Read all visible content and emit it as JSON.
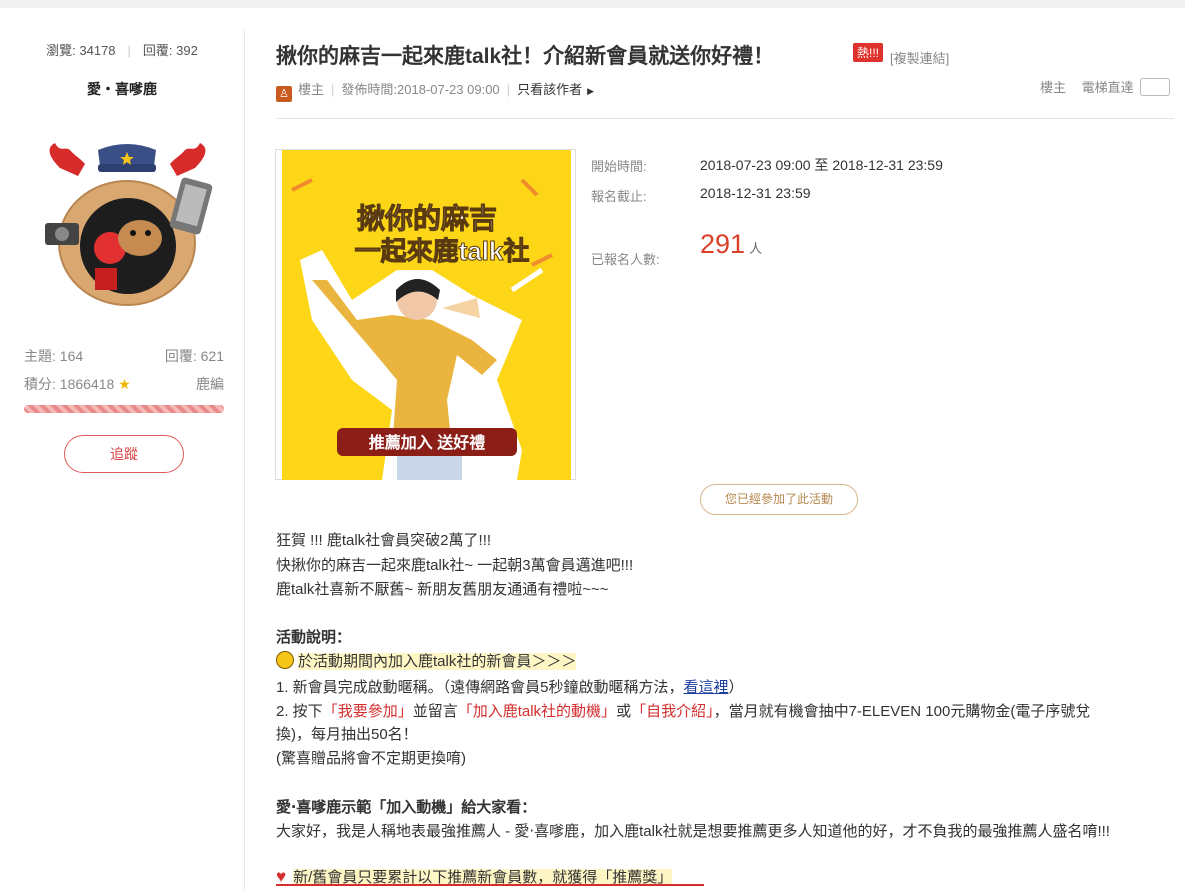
{
  "user": {
    "views_label": "瀏覽: 34178",
    "replies_label": "回覆: 392",
    "name": "愛・喜嗲鹿",
    "topics": "主題: 164",
    "reply_count": "回覆: 621",
    "points": "積分: 1866418",
    "rank": "鹿編",
    "follow_label": "追蹤"
  },
  "post": {
    "title": "揪你的麻吉一起來鹿talk社！介紹新會員就送你好禮！",
    "hot_badge": "熱!!!",
    "copy_link": "[複製連結]",
    "meta": {
      "floor": "樓主",
      "published": "發佈時間:2018-07-23 09:00",
      "author_only": "只看該作者"
    },
    "tools": {
      "floor": "樓主",
      "elevator": "電梯直達"
    }
  },
  "poster": {
    "line1": "揪你的麻吉",
    "line2": "一起來鹿talk社",
    "cta": "推薦加入 送好禮"
  },
  "event": {
    "start_label": "開始時間:",
    "start_value": "2018-07-23 09:00 至 2018-12-31 23:59",
    "deadline_label": "報名截止:",
    "deadline_value": "2018-12-31 23:59",
    "count_label": "已報名人數:",
    "count_value": "291",
    "count_unit": "人",
    "joined_button": "您已經參加了此活動"
  },
  "body": {
    "p1": "狂賀 !!! 鹿talk社會員突破2萬了!!!",
    "p2": "快揪你的麻吉一起來鹿talk社~ 一起朝3萬會員邁進吧!!!",
    "p3": "鹿talk社喜新不厭舊~ 新朋友舊朋友通通有禮啦~~~",
    "section_title": "活動說明：",
    "highlight1": "於活動期間內加入鹿talk社的新會員＞＞＞",
    "step1_a": "1. 新會員完成啟動暱稱。（遠傳網路會員5秒鐘啟動暱稱方法，",
    "step1_link": "看這裡",
    "step1_b": "）",
    "step2_a": "2. 按下",
    "step2_r1": "「我要參加」",
    "step2_b": "並留言",
    "step2_r2": "「加入鹿talk社的動機」",
    "step2_c": "或",
    "step2_r3": "「自我介紹」",
    "step2_d": "，當月就有機會抽中7-ELEVEN 100元購物金(電子序號兌",
    "step2_e": "換)，每月抽出50名！",
    "note": "(驚喜贈品將會不定期更換唷)",
    "demo_title": "愛‧喜嗲鹿示範「加入動機」給大家看：",
    "demo_text": "大家好，我是人稱地表最強推薦人 - 愛‧喜嗲鹿，加入鹿talk社就是想要推薦更多人知道他的好，才不負我的最強推薦人盛名唷!!!",
    "highlight2": "新/舊會員只要累計以下推薦新會員數，就獲得「推薦獎」"
  }
}
